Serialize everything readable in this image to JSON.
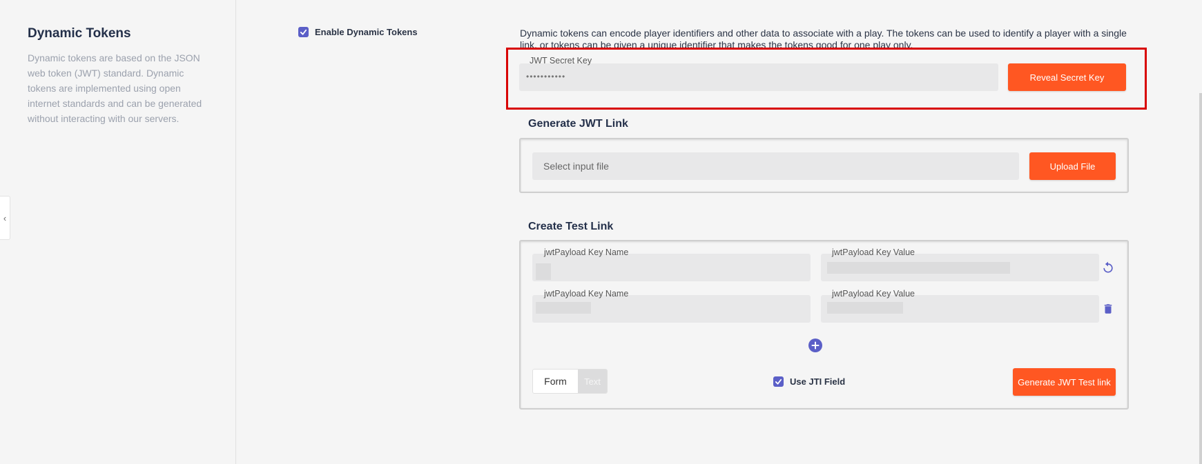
{
  "sidebar": {
    "title": "Dynamic Tokens",
    "description": "Dynamic tokens are based on the JSON web token (JWT) standard. Dynamic tokens are implemented using open internet standards and can be generated without interacting with our servers."
  },
  "enable": {
    "label": "Enable Dynamic Tokens",
    "checked": true
  },
  "intro": {
    "text": "Dynamic tokens can encode player identifiers and other data to associate with a play. The tokens can be used to identify a player with a single link, or tokens can be given a unique identifier that makes the tokens good for one play only."
  },
  "secret": {
    "label": "JWT Secret Key",
    "value": "•••••••••••",
    "reveal_button": "Reveal Secret Key"
  },
  "generate": {
    "title": "Generate JWT Link",
    "file_placeholder": "Select input file",
    "upload_button": "Upload File"
  },
  "test_link": {
    "title": "Create Test Link",
    "rows": [
      {
        "key_label": "jwtPayload Key Name",
        "value_label": "jwtPayload Key Value",
        "action_icon": "refresh-icon"
      },
      {
        "key_label": "jwtPayload Key Name",
        "value_label": "jwtPayload Key Value",
        "action_icon": "trash-icon"
      }
    ],
    "add_icon": "plus-circle-icon",
    "mode_options": [
      "Form",
      "Text"
    ],
    "mode_selected": "Form",
    "jti_label": "Use JTI Field",
    "jti_checked": true,
    "generate_button": "Generate JWT Test link"
  },
  "colors": {
    "accent": "#ff5722",
    "checkbox": "#5b5fc7",
    "highlight": "#d80000"
  }
}
